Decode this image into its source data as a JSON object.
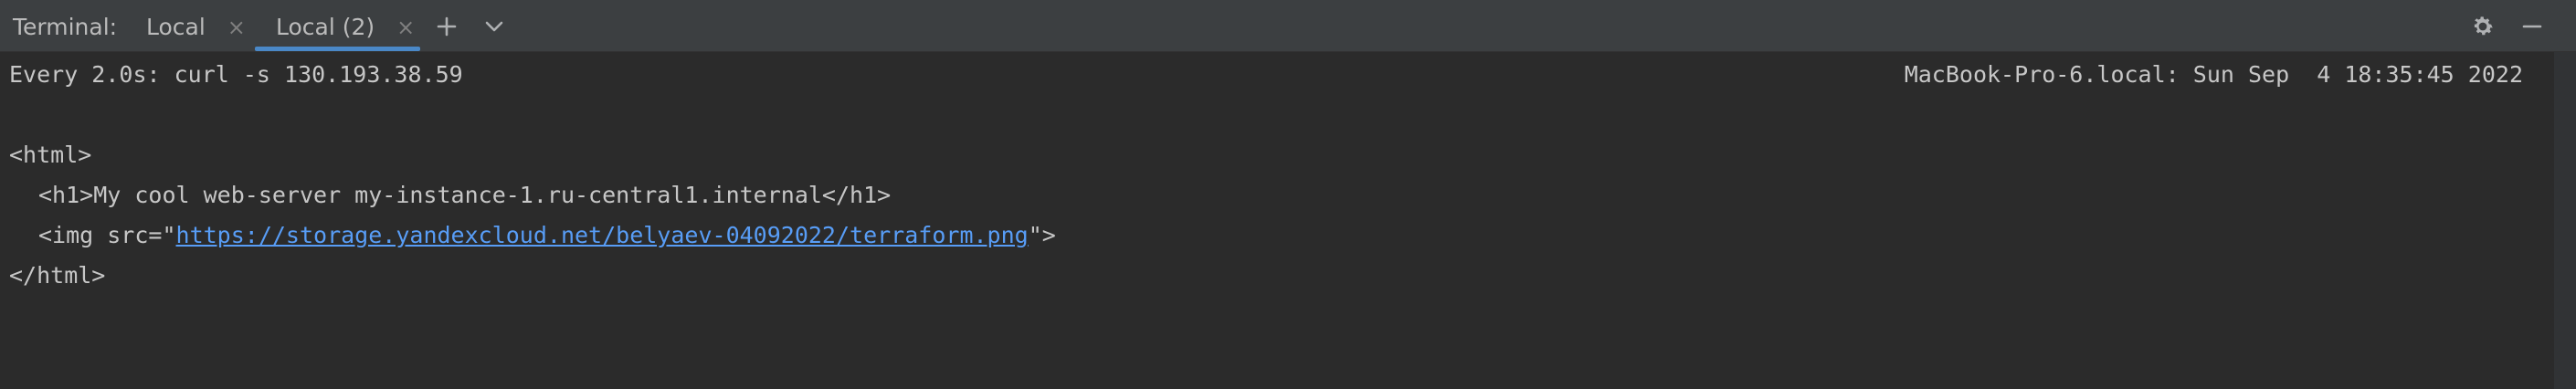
{
  "tabbar": {
    "label": "Terminal:",
    "tabs": [
      {
        "label": "Local",
        "close": "×",
        "active": false
      },
      {
        "label": "Local (2)",
        "close": "×",
        "active": true
      }
    ],
    "add_icon": "plus-icon",
    "dropdown_icon": "chevron-down-icon",
    "settings_icon": "gear-icon",
    "minimize_icon": "minimize-icon",
    "accent_color": "#4a88c7"
  },
  "terminal": {
    "watch_command": "Every 2.0s: curl -s 130.193.38.59",
    "host_and_time": "MacBook-Pro-6.local: Sun Sep  4 18:35:45 2022",
    "lines": [
      "<html>",
      "<h1>My cool web-server my-instance-1.ru-central1.internal</h1>"
    ],
    "img_prefix": "<img src=\"",
    "img_url": "https://storage.yandexcloud.net/belyaev-04092022/terraform.png",
    "img_suffix": "\">",
    "closing": "</html>",
    "link_color": "#589df6"
  }
}
